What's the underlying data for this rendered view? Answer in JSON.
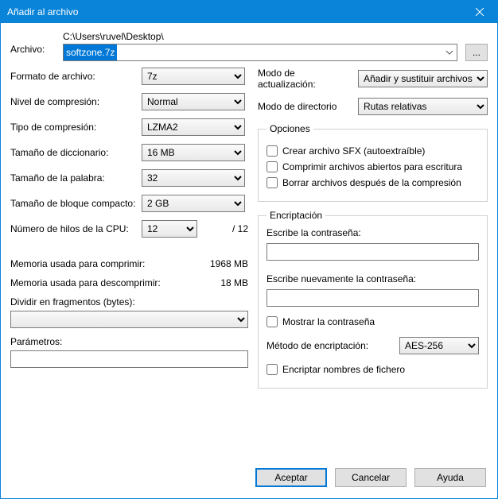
{
  "window": {
    "title": "Añadir al archivo"
  },
  "file": {
    "label": "Archivo:",
    "path": "C:\\Users\\ruvel\\Desktop\\",
    "name": "softzone.7z",
    "browse": "..."
  },
  "left": {
    "format_label": "Formato de archivo:",
    "format_value": "7z",
    "level_label": "Nivel de compresión:",
    "level_value": "Normal",
    "method_label": "Tipo de compresión:",
    "method_value": "LZMA2",
    "dict_label": "Tamaño de diccionario:",
    "dict_value": "16 MB",
    "word_label": "Tamaño de la palabra:",
    "word_value": "32",
    "solid_label": "Tamaño de bloque compacto:",
    "solid_value": "2 GB",
    "threads_label": "Número de hilos de la CPU:",
    "threads_value": "12",
    "threads_max": "/ 12",
    "mem_compress_label": "Memoria usada para comprimir:",
    "mem_compress_value": "1968 MB",
    "mem_decompress_label": "Memoria usada para descomprimir:",
    "mem_decompress_value": "18 MB",
    "split_label": "Dividir en fragmentos (bytes):",
    "split_value": "",
    "params_label": "Parámetros:",
    "params_value": ""
  },
  "right": {
    "update_label": "Modo de actualización:",
    "update_value": "Añadir y sustituir archivos",
    "path_label": "Modo de directorio",
    "path_value": "Rutas relativas",
    "options_legend": "Opciones",
    "opt_sfx": "Crear archivo SFX (autoextraíble)",
    "opt_shared": "Comprimir archivos abiertos para escritura",
    "opt_delete": "Borrar archivos después de la compresión",
    "enc_legend": "Encriptación",
    "enc_pw_label": "Escribe la contraseña:",
    "enc_pw2_label": "Escribe nuevamente la contraseña:",
    "enc_show": "Mostrar la contraseña",
    "enc_method_label": "Método de encriptación:",
    "enc_method_value": "AES-256",
    "enc_names": "Encriptar nombres de fichero"
  },
  "actions": {
    "ok": "Aceptar",
    "cancel": "Cancelar",
    "help": "Ayuda"
  }
}
